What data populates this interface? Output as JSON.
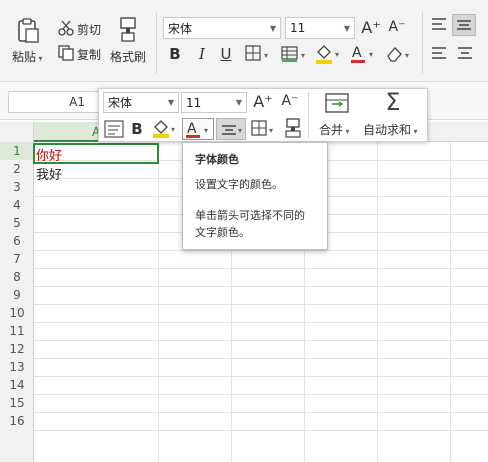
{
  "ribbon": {
    "paste_label": "粘贴",
    "cut_label": "剪切",
    "copy_label": "复制",
    "format_painter_label": "格式刷",
    "font_name": "宋体",
    "font_size": "11",
    "bold": "B",
    "italic": "I",
    "underline": "U",
    "font_color_letter": "A",
    "grow_font": "A⁺",
    "shrink_font": "A⁻"
  },
  "formula_bar": {
    "name_box": "A1"
  },
  "mini_toolbar": {
    "font_name": "宋体",
    "font_size": "11",
    "bold": "B",
    "font_color_letter": "A",
    "merge_label": "合并",
    "autosum_label": "自动求和",
    "sum_symbol": "Σ",
    "font_color_underline": "#d32f2f",
    "fill_color_underline": "#f5d000"
  },
  "tooltip": {
    "title": "字体颜色",
    "line1": "设置文字的颜色。",
    "line2": "单击箭头可选择不同的",
    "line3": "文字颜色。"
  },
  "sheet": {
    "col_a": "A",
    "rows": [
      "1",
      "2",
      "3",
      "4",
      "5",
      "6",
      "7",
      "8",
      "9",
      "10",
      "11",
      "12",
      "13",
      "14",
      "15",
      "16"
    ],
    "cells": {
      "a1": "你好",
      "a2": "我好"
    },
    "a1_color": "#c00000",
    "selection_color": "#2e8b3a"
  }
}
